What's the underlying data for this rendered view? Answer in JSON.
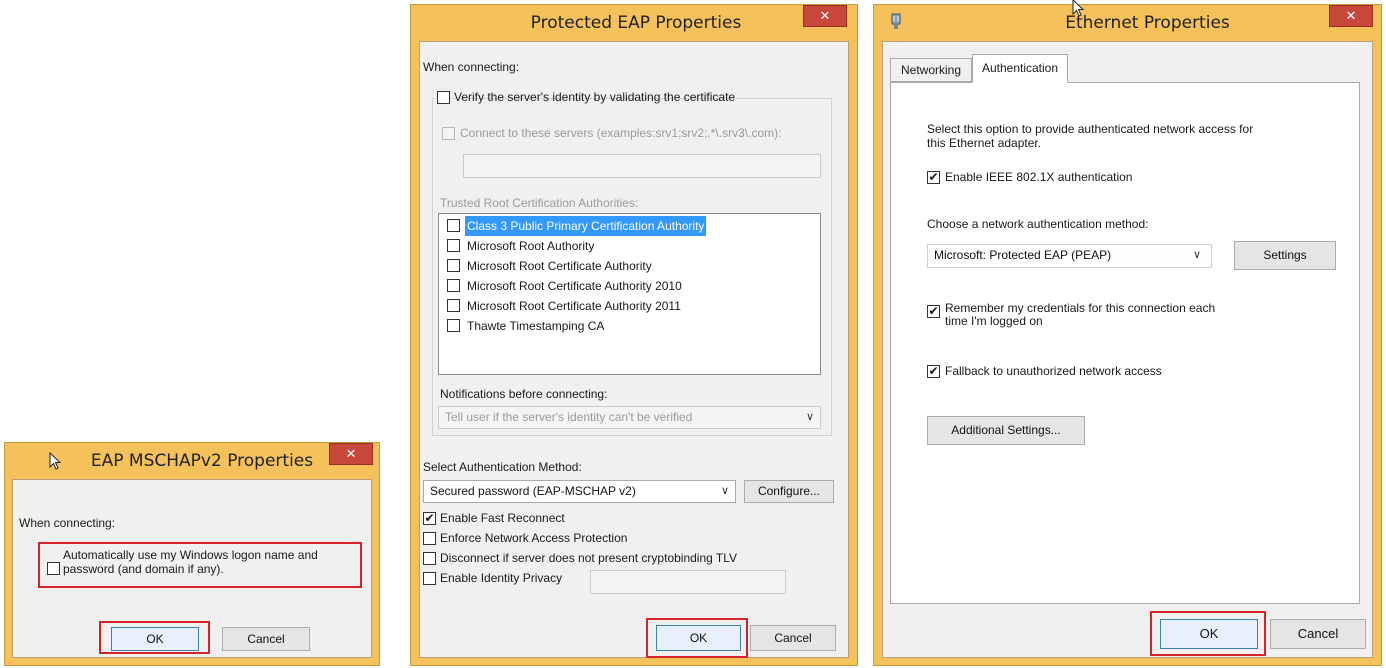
{
  "mschap": {
    "title": "EAP MSCHAPv2 Properties",
    "close": "✕",
    "when_connecting": "When connecting:",
    "auto_logon_line1": "Automatically use my Windows logon name and",
    "auto_logon_line2": "password (and domain if any).",
    "auto_logon_checked": false,
    "ok": "OK",
    "cancel": "Cancel"
  },
  "peap": {
    "title": "Protected EAP Properties",
    "close": "✕",
    "when_connecting": "When connecting:",
    "verify_server": "Verify the server's identity by validating the certificate",
    "verify_checked": false,
    "connect_servers": "Connect to these servers (examples:srv1;srv2;.*\\.srv3\\.com):",
    "servers_value": "",
    "trusted_root_label": "Trusted Root Certification Authorities:",
    "ca_items": [
      {
        "label": "Class 3 Public Primary Certification Authority",
        "checked": false,
        "selected": true
      },
      {
        "label": "Microsoft Root Authority",
        "checked": false,
        "selected": false
      },
      {
        "label": "Microsoft Root Certificate Authority",
        "checked": false,
        "selected": false
      },
      {
        "label": "Microsoft Root Certificate Authority 2010",
        "checked": false,
        "selected": false
      },
      {
        "label": "Microsoft Root Certificate Authority 2011",
        "checked": false,
        "selected": false
      },
      {
        "label": "Thawte Timestamping CA",
        "checked": false,
        "selected": false
      }
    ],
    "notifications_label": "Notifications before connecting:",
    "notifications_value": "Tell user if the server's identity can't be verified",
    "select_method_label": "Select Authentication Method:",
    "method_value": "Secured password (EAP-MSCHAP v2)",
    "configure": "Configure...",
    "opt_fast_reconnect": "Enable Fast Reconnect",
    "opt_fast_reconnect_checked": true,
    "opt_nap": "Enforce Network Access Protection",
    "opt_nap_checked": false,
    "opt_cryptobinding": "Disconnect if server does not present cryptobinding TLV",
    "opt_cryptobinding_checked": false,
    "opt_identity_privacy": "Enable Identity Privacy",
    "opt_identity_privacy_checked": false,
    "identity_value": "",
    "ok": "OK",
    "cancel": "Cancel"
  },
  "ethernet": {
    "title": "Ethernet Properties",
    "close": "✕",
    "tabs": [
      "Networking",
      "Authentication"
    ],
    "active_tab": "Authentication",
    "description_line1": "Select this option to provide authenticated network access for",
    "description_line2": "this Ethernet adapter.",
    "enable_8021x": "Enable IEEE 802.1X authentication",
    "enable_8021x_checked": true,
    "choose_method_label": "Choose a network authentication method:",
    "method_value": "Microsoft: Protected EAP (PEAP)",
    "settings": "Settings",
    "remember_line1": "Remember my credentials for this connection each",
    "remember_line2": "time I'm logged on",
    "remember_checked": true,
    "fallback": "Fallback to unauthorized network access",
    "fallback_checked": true,
    "additional_settings": "Additional Settings...",
    "ok": "OK",
    "cancel": "Cancel"
  },
  "colors": {
    "window_frame": "#f4c15a",
    "close_button": "#c7473b",
    "highlight_box": "#d6232c",
    "selection": "#3399ff"
  }
}
